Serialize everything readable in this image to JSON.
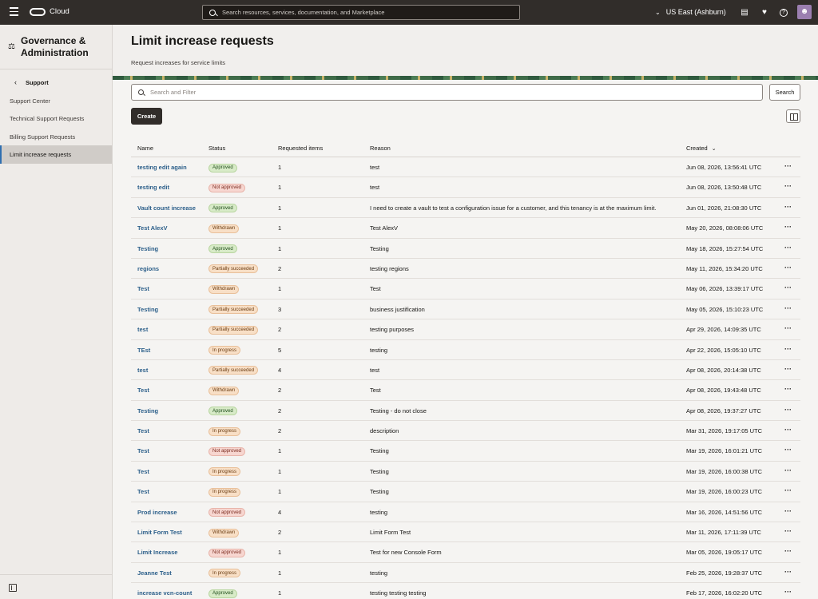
{
  "topbar": {
    "brand": "Cloud",
    "search_placeholder": "Search resources, services, documentation, and Marketplace",
    "region": "US East (Ashburn)"
  },
  "sidebar": {
    "title": "Governance & Administration",
    "section": "Support",
    "items": [
      {
        "label": "Support Center"
      },
      {
        "label": "Technical Support Requests"
      },
      {
        "label": "Billing Support Requests"
      },
      {
        "label": "Limit increase requests"
      }
    ]
  },
  "header": {
    "title": "Limit increase requests",
    "subtitle": "Request increases for service limits"
  },
  "toolbar": {
    "filter_placeholder": "Search and Filter",
    "search_label": "Search",
    "create_label": "Create"
  },
  "table": {
    "columns": [
      "Name",
      "Status",
      "Requested items",
      "Reason",
      "Created"
    ],
    "rows": [
      {
        "name": "testing edit again",
        "status": "Approved",
        "items": "1",
        "reason": "test",
        "created": "Jun 08, 2026, 13:56:41 UTC"
      },
      {
        "name": "testing edit",
        "status": "Not approved",
        "items": "1",
        "reason": "test",
        "created": "Jun 08, 2026, 13:50:48 UTC"
      },
      {
        "name": "Vault count increase",
        "status": "Approved",
        "items": "1",
        "reason": "I need to create a vault to test a configuration issue for a customer, and this tenancy is at the maximum limit.",
        "created": "Jun 01, 2026, 21:08:30 UTC"
      },
      {
        "name": "Test AlexV",
        "status": "Withdrawn",
        "items": "1",
        "reason": "Test AlexV",
        "created": "May 20, 2026, 08:08:06 UTC"
      },
      {
        "name": "Testing",
        "status": "Approved",
        "items": "1",
        "reason": "Testing",
        "created": "May 18, 2026, 15:27:54 UTC"
      },
      {
        "name": "regions",
        "status": "Partially succeeded",
        "items": "2",
        "reason": "testing regions",
        "created": "May 11, 2026, 15:34:20 UTC"
      },
      {
        "name": "Test",
        "status": "Withdrawn",
        "items": "1",
        "reason": "Test",
        "created": "May 06, 2026, 13:39:17 UTC"
      },
      {
        "name": "Testing",
        "status": "Partially succeeded",
        "items": "3",
        "reason": "business justification",
        "created": "May 05, 2026, 15:10:23 UTC"
      },
      {
        "name": "test",
        "status": "Partially succeeded",
        "items": "2",
        "reason": "testing purposes",
        "created": "Apr 29, 2026, 14:09:35 UTC"
      },
      {
        "name": "TEst",
        "status": "In progress",
        "items": "5",
        "reason": "testing",
        "created": "Apr 22, 2026, 15:05:10 UTC"
      },
      {
        "name": "test",
        "status": "Partially succeeded",
        "items": "4",
        "reason": "test",
        "created": "Apr 08, 2026, 20:14:38 UTC"
      },
      {
        "name": "Test",
        "status": "Withdrawn",
        "items": "2",
        "reason": "Test",
        "created": "Apr 08, 2026, 19:43:48 UTC"
      },
      {
        "name": "Testing",
        "status": "Approved",
        "items": "2",
        "reason": "Testing - do not close",
        "created": "Apr 08, 2026, 19:37:27 UTC"
      },
      {
        "name": "Test",
        "status": "In progress",
        "items": "2",
        "reason": "description",
        "created": "Mar 31, 2026, 19:17:05 UTC"
      },
      {
        "name": "Test",
        "status": "Not approved",
        "items": "1",
        "reason": "Testing",
        "created": "Mar 19, 2026, 16:01:21 UTC"
      },
      {
        "name": "Test",
        "status": "In progress",
        "items": "1",
        "reason": "Testing",
        "created": "Mar 19, 2026, 16:00:38 UTC"
      },
      {
        "name": "Test",
        "status": "In progress",
        "items": "1",
        "reason": "Testing",
        "created": "Mar 19, 2026, 16:00:23 UTC"
      },
      {
        "name": "Prod increase",
        "status": "Not approved",
        "items": "4",
        "reason": "testing",
        "created": "Mar 16, 2026, 14:51:56 UTC"
      },
      {
        "name": "Limit Form Test",
        "status": "Withdrawn",
        "items": "2",
        "reason": "Limit Form Test",
        "created": "Mar 11, 2026, 17:11:39 UTC"
      },
      {
        "name": "Limit Increase",
        "status": "Not approved",
        "items": "1",
        "reason": "Test for new Console Form",
        "created": "Mar 05, 2026, 19:05:17 UTC"
      },
      {
        "name": "Jeanne Test",
        "status": "In progress",
        "items": "1",
        "reason": "testing",
        "created": "Feb 25, 2026, 19:28:37 UTC"
      },
      {
        "name": "increase vcn-count",
        "status": "Approved",
        "items": "1",
        "reason": "testing testing testing",
        "created": "Feb 17, 2026, 16:02:20 UTC"
      }
    ]
  },
  "colors": {
    "topbar": "#312d2a",
    "link": "#2c5f8a",
    "approved": "#d8ebc8",
    "not_approved": "#f7d6d0",
    "warning": "#f8dfc6"
  }
}
